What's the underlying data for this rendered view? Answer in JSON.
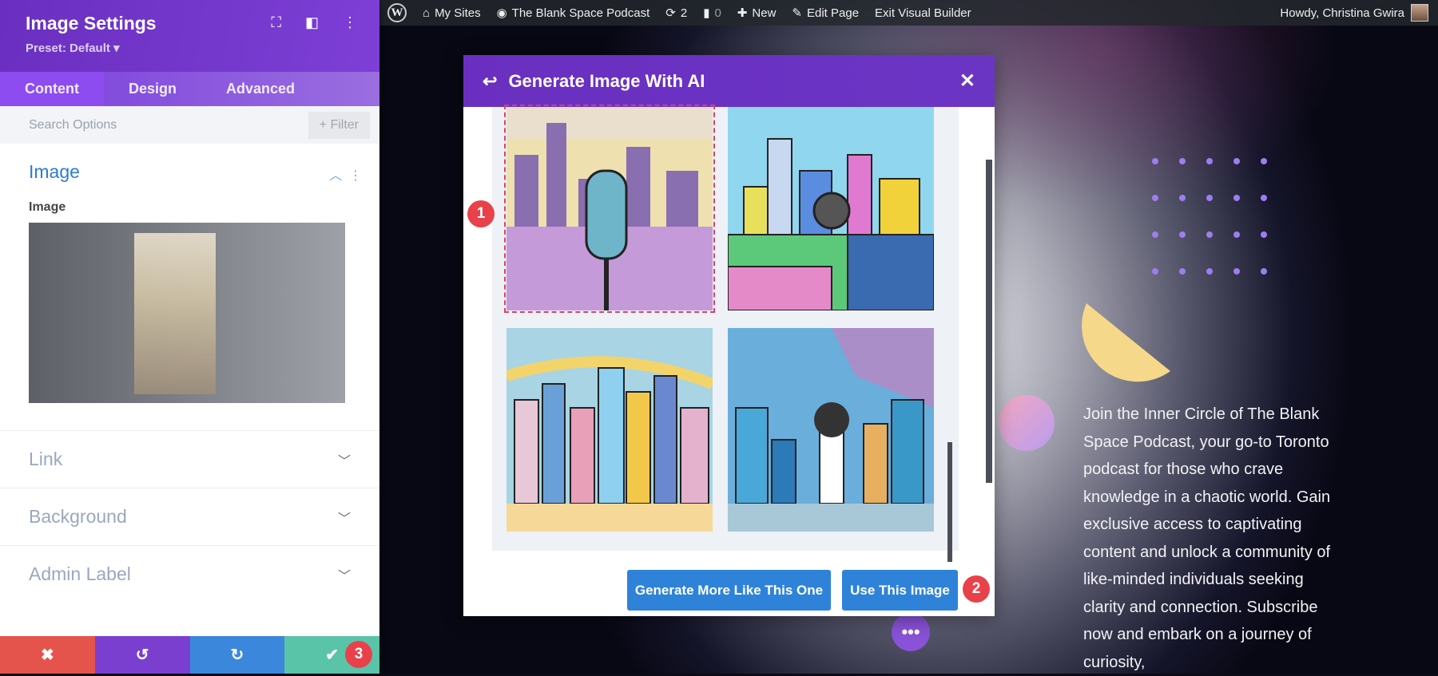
{
  "admin_bar": {
    "my_sites": "My Sites",
    "site": "The Blank Space Podcast",
    "updates": "2",
    "comments": "0",
    "new": "New",
    "edit_page": "Edit Page",
    "exit": "Exit Visual Builder",
    "howdy": "Howdy, Christina Gwira"
  },
  "panel": {
    "title": "Image Settings",
    "preset": "Preset: Default ▾",
    "tabs": [
      "Content",
      "Design",
      "Advanced"
    ],
    "search_placeholder": "Search Options",
    "filter": "+ Filter",
    "section_title": "Image",
    "image_label": "Image",
    "rows": [
      "Link",
      "Background",
      "Admin Label"
    ]
  },
  "modal": {
    "title": "Generate Image With AI",
    "generate_more": "Generate More Like This One",
    "use_image": "Use This Image"
  },
  "badges": [
    "1",
    "2",
    "3"
  ],
  "page_text": "Join the Inner Circle of The Blank Space Podcast, your go-to Toronto podcast for those who crave knowledge in a chaotic world. Gain exclusive access to captivating content and unlock a community of like-minded individuals seeking clarity and connection. Subscribe now and embark on a journey of curiosity,",
  "colors": {
    "purple": "#6a2fc0",
    "blue": "#2e83d9",
    "red": "#e8414a",
    "green": "#5ac4a8"
  }
}
